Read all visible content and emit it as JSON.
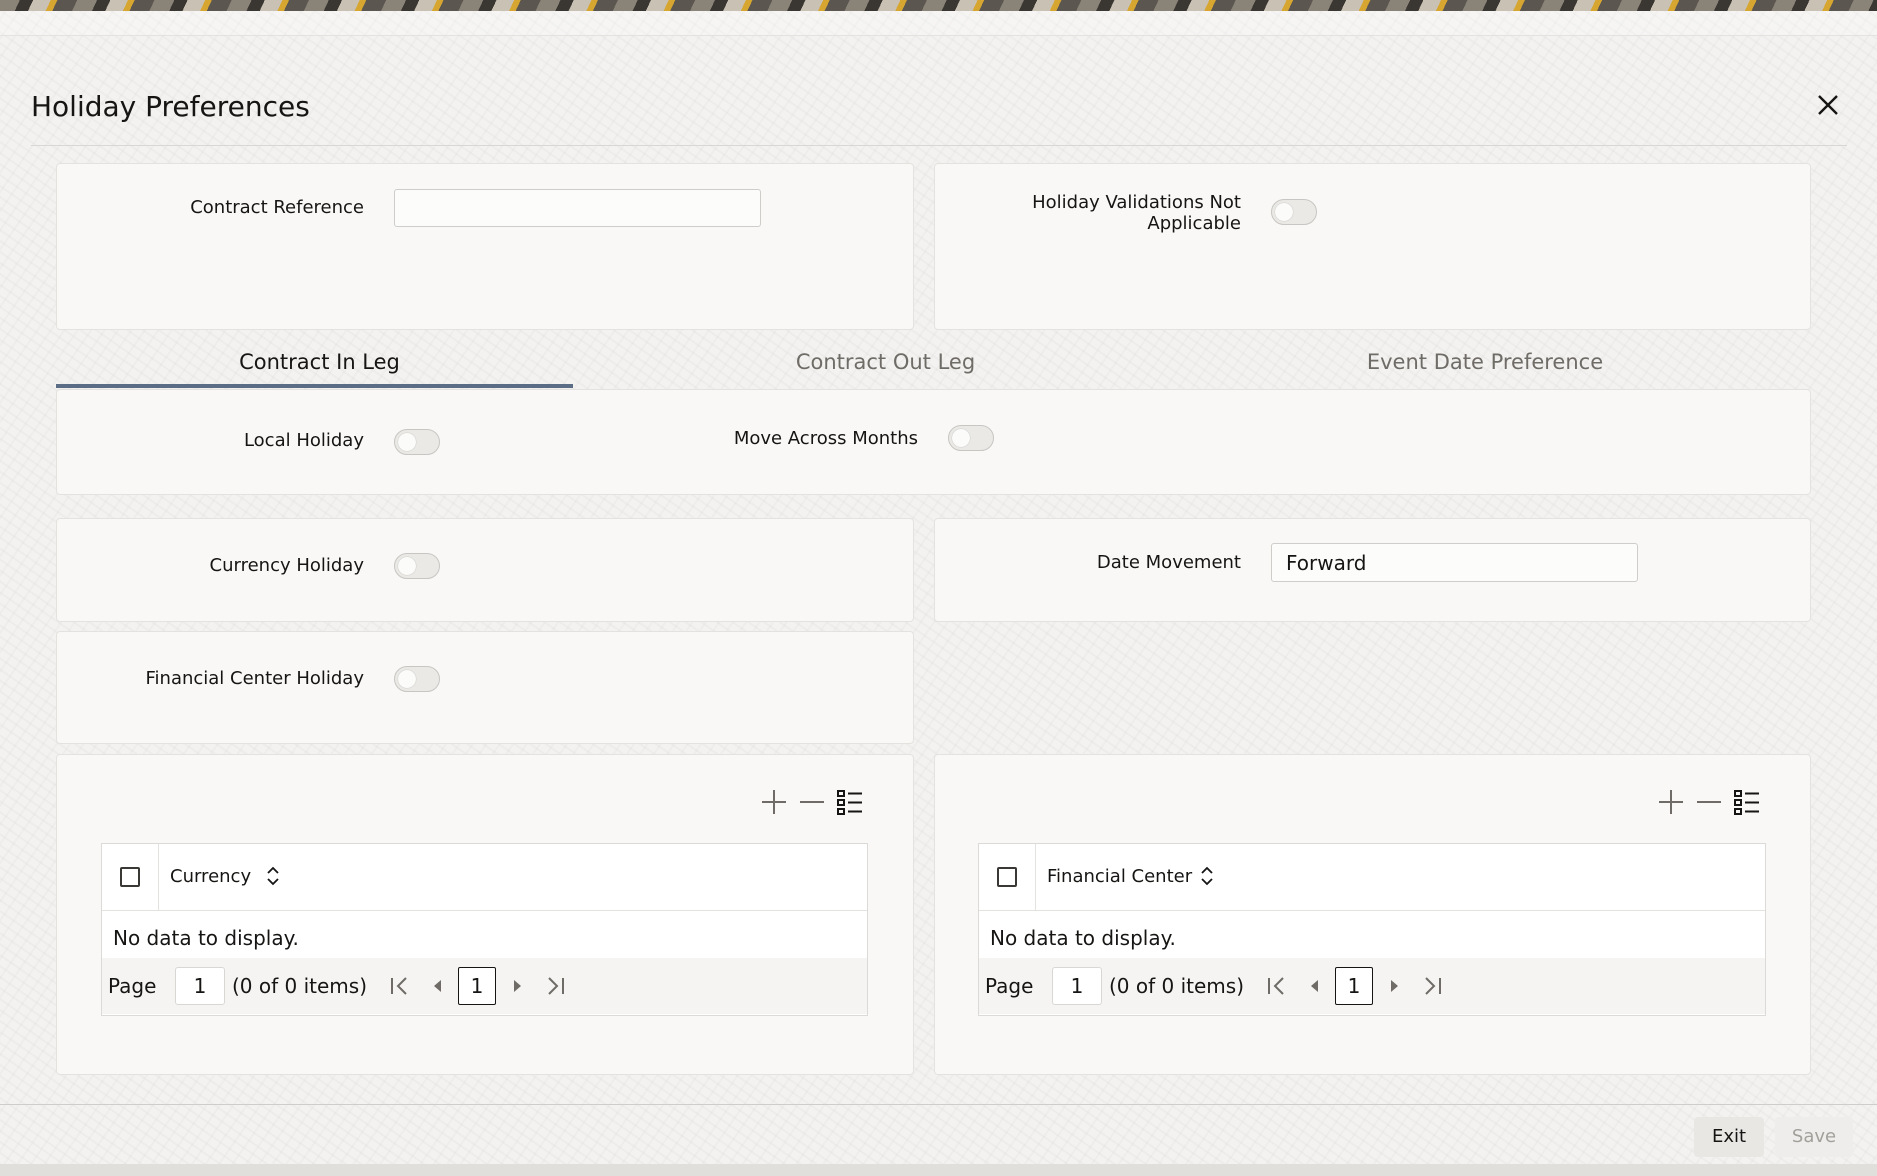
{
  "dialog": {
    "title": "Holiday Preferences"
  },
  "header": {
    "contract_reference_label": "Contract Reference",
    "contract_reference_value": "",
    "holiday_validations_label_line1": "Holiday Validations Not",
    "holiday_validations_label_line2": "Applicable",
    "holiday_validations_not_applicable": false
  },
  "tabs": [
    {
      "label": "Contract In Leg",
      "active": true
    },
    {
      "label": "Contract Out Leg",
      "active": false
    },
    {
      "label": "Event Date Preference",
      "active": false
    }
  ],
  "contract_in_leg": {
    "local_holiday_label": "Local Holiday",
    "local_holiday": false,
    "move_across_months_label": "Move Across Months",
    "move_across_months": false,
    "currency_holiday_label": "Currency Holiday",
    "currency_holiday": false,
    "date_movement_label": "Date Movement",
    "date_movement_value": "Forward",
    "financial_center_holiday_label": "Financial Center Holiday",
    "financial_center_holiday": false
  },
  "currency_table": {
    "column_header": "Currency",
    "empty_text": "No data to display.",
    "page_label": "Page",
    "page_value": "1",
    "count_text": "(0 of 0 items)",
    "current_page": "1"
  },
  "financial_center_table": {
    "column_header": "Financial Center",
    "empty_text": "No data to display.",
    "page_label": "Page",
    "page_value": "1",
    "count_text": "(0 of 0 items)",
    "current_page": "1"
  },
  "footer": {
    "exit_label": "Exit",
    "save_label": "Save"
  },
  "colors": {
    "tab_underline": "#5b6d85",
    "disabled_text": "#a3a09b"
  }
}
